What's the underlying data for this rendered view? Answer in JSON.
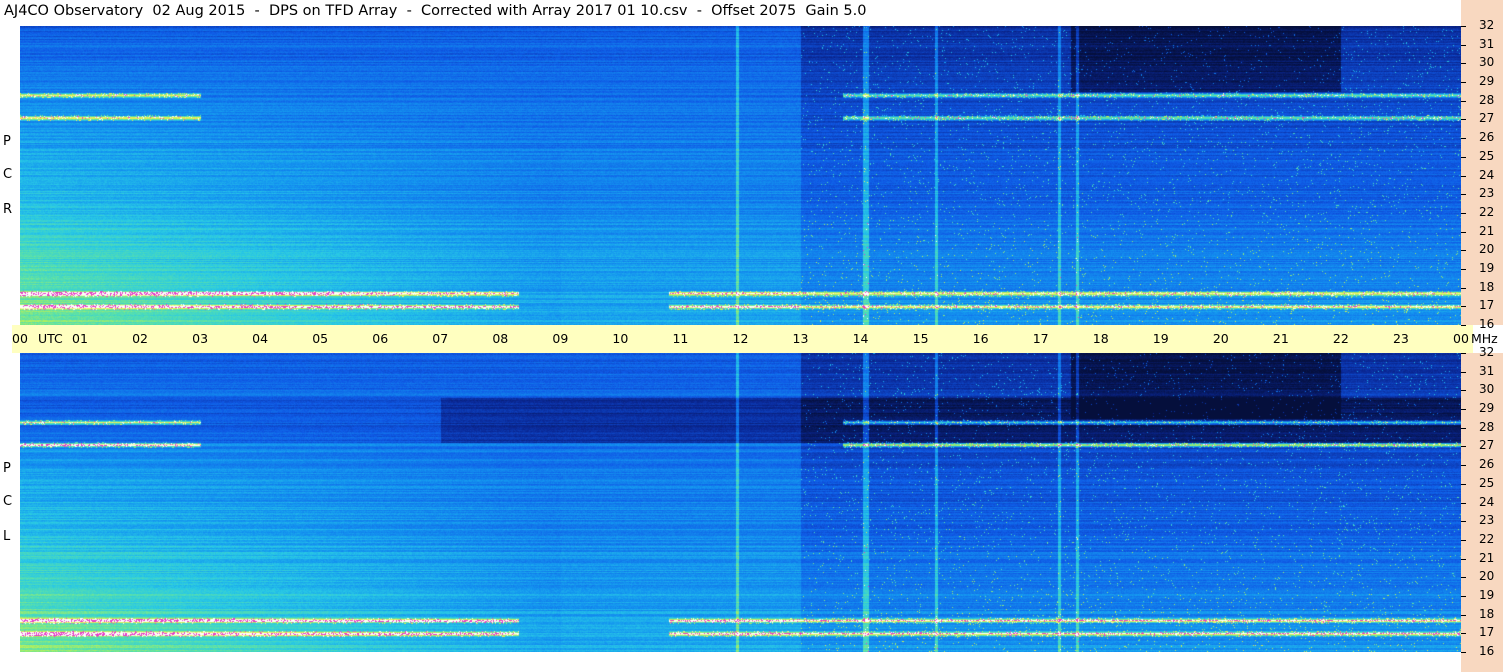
{
  "title": "AJ4CO Observatory  02 Aug 2015  -  DPS on TFD Array  -  Corrected with Array 2017 01 10.csv  -  Offset 2075  Gain 5.0",
  "chart_data": [
    {
      "type": "heatmap",
      "name": "RCP",
      "polarization_label": [
        "R",
        "C",
        "P"
      ],
      "x_label": "UTC",
      "x_ticks": [
        "00",
        "01",
        "02",
        "03",
        "04",
        "05",
        "06",
        "07",
        "08",
        "09",
        "10",
        "11",
        "12",
        "13",
        "14",
        "15",
        "16",
        "17",
        "18",
        "19",
        "20",
        "21",
        "22",
        "23",
        "00"
      ],
      "x_range_hours": [
        0,
        24
      ],
      "y_label": "MHz",
      "y_ticks": [
        "16",
        "17",
        "18",
        "19",
        "20",
        "21",
        "22",
        "23",
        "24",
        "25",
        "26",
        "27",
        "28",
        "29",
        "30",
        "31",
        "32"
      ],
      "y_range_mhz": [
        16,
        32
      ],
      "features": {
        "strong_bands_mhz": [
          17,
          17.7,
          27.1,
          28.3
        ],
        "vertical_lines_utc": [
          11.95,
          14.05,
          14.1,
          15.25,
          17.3,
          17.6
        ]
      }
    },
    {
      "type": "heatmap",
      "name": "LCP",
      "polarization_label": [
        "L",
        "C",
        "P"
      ],
      "x_ticks": [
        "00",
        "01",
        "02",
        "03",
        "04",
        "05",
        "06",
        "07",
        "08",
        "09",
        "10",
        "11",
        "12",
        "13",
        "14",
        "15",
        "16",
        "17",
        "18",
        "19",
        "20",
        "21",
        "22",
        "23",
        "00"
      ],
      "x_range_hours": [
        0,
        24
      ],
      "y_ticks": [
        "16",
        "17",
        "18",
        "19",
        "20",
        "21",
        "22",
        "23",
        "24",
        "25",
        "26",
        "27",
        "28",
        "29",
        "30",
        "31",
        "32"
      ],
      "y_range_mhz": [
        16,
        32
      ],
      "features": {
        "strong_bands_mhz": [
          17,
          17.7,
          27.1,
          28.3
        ],
        "vertical_lines_utc": [
          11.95,
          14.05,
          14.1,
          15.25,
          17.3,
          17.6
        ]
      }
    }
  ],
  "colors": {
    "axis_bg_time": "#ffffc0",
    "axis_bg_freq": "#f8d8c0"
  }
}
